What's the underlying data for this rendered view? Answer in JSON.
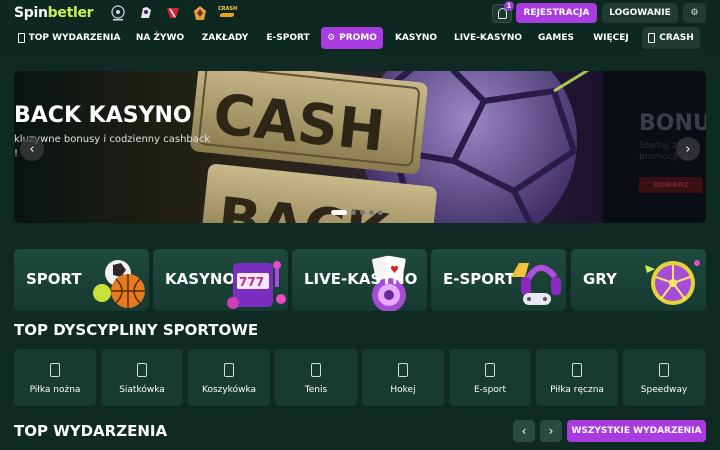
{
  "header": {
    "logo_part1": "Spin",
    "logo_part2": "betler",
    "partners": [
      "champions-league-logo",
      "premier-league-logo",
      "team-crest-red",
      "club-crest",
      "crash-logo"
    ],
    "crash_logo_text": "CRASH",
    "notification_count": "1",
    "register_label": "REJESTRACJA",
    "login_label": "LOGOWANIE",
    "settings_icon": "gear-icon"
  },
  "nav": {
    "items": [
      {
        "label": "TOP WYDARZENIA",
        "icon": "phone-icon"
      },
      {
        "label": "NA ŻYWO"
      },
      {
        "label": "ZAKŁADY"
      },
      {
        "label": "E-SPORT"
      },
      {
        "label": "PROMO",
        "icon": "gear-icon",
        "highlight": true
      },
      {
        "label": "KASYNO"
      },
      {
        "label": "LIVE-KASYNO"
      },
      {
        "label": "GAMES"
      },
      {
        "label": "WIĘCEJ"
      },
      {
        "label": "CRASH",
        "icon": "phone-icon"
      }
    ]
  },
  "hero": {
    "title": "BACK KASYNO",
    "subtitle": "kluzywne bonusy i codzienny cashback",
    "subtitle2": "!",
    "art_text1": "CASH",
    "art_text2": "BACK",
    "next_title": "BONU",
    "next_sub1": "Startuj z",
    "next_sub2": "promocji w",
    "next_button": "ODBIERZ",
    "slide_count": 5,
    "active_slide": 1
  },
  "categories": [
    {
      "label": "SPORT"
    },
    {
      "label": "KASYNO"
    },
    {
      "label": "LIVE-KASYNO"
    },
    {
      "label": "E-SPORT"
    },
    {
      "label": "GRY"
    }
  ],
  "sports_section": {
    "title": "TOP DYSCYPLINY SPORTOWE",
    "items": [
      {
        "label": "Piłka nożna"
      },
      {
        "label": "Siatkówka"
      },
      {
        "label": "Koszykówka"
      },
      {
        "label": "Tenis"
      },
      {
        "label": "Hokej"
      },
      {
        "label": "E-sport"
      },
      {
        "label": "Piłka ręczna"
      },
      {
        "label": "Speedway"
      }
    ]
  },
  "events_section": {
    "title": "TOP WYDARZENIA",
    "prev_label": "‹",
    "next_label": "›",
    "all_label": "WSZYSTKIE WYDARZENIA"
  },
  "colors": {
    "background": "#0f2a22",
    "accent": "#a93be0",
    "tile": "#173a31",
    "logo_green": "#c8f25a"
  }
}
